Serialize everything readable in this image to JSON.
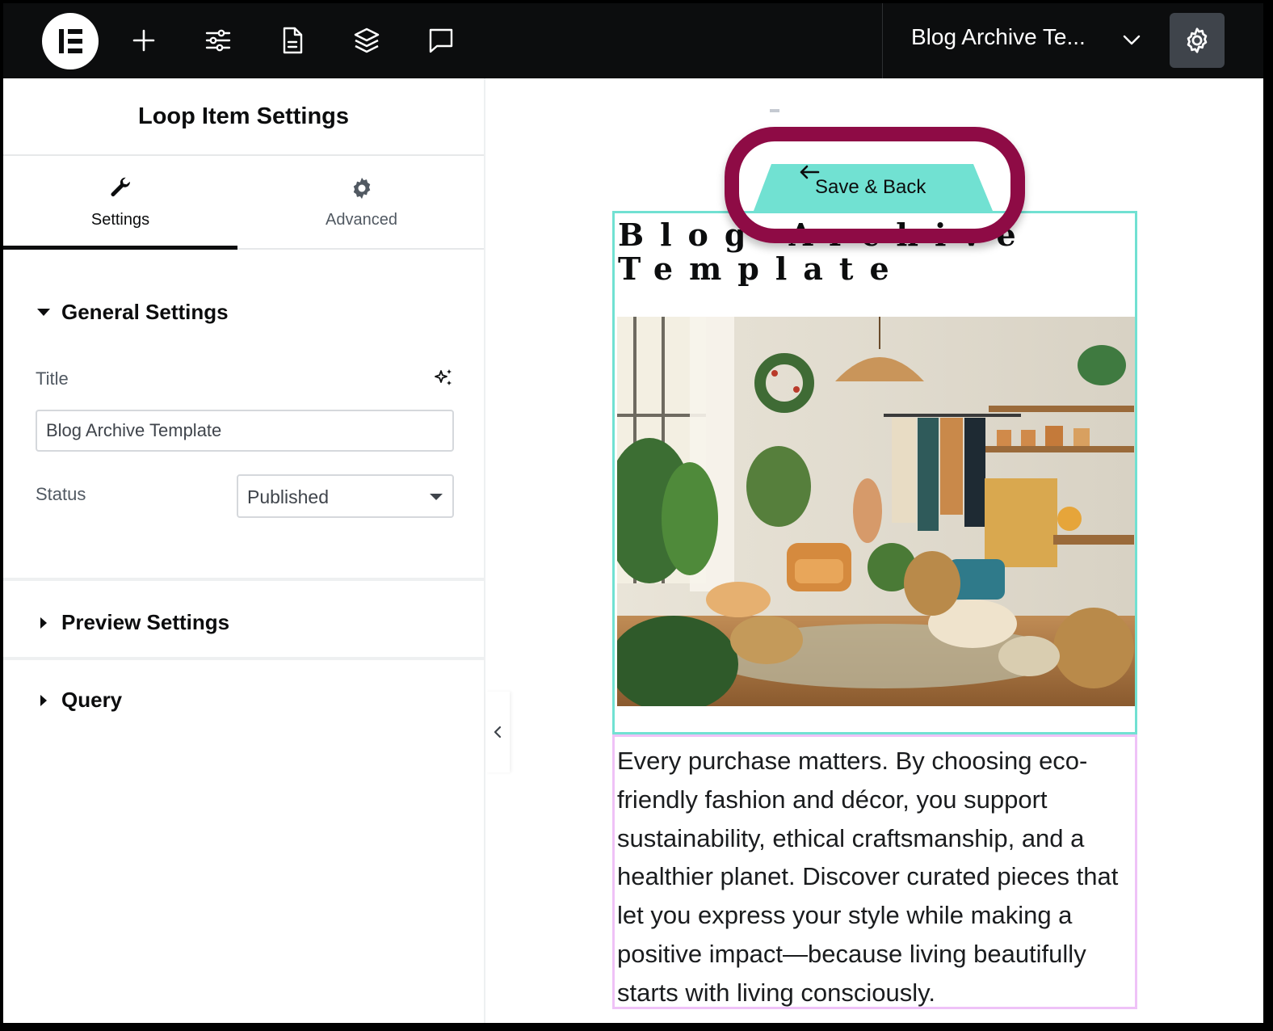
{
  "topbar": {
    "document_title": "Blog Archive Te...",
    "icons": [
      "elementor-logo-icon",
      "add-icon",
      "site-settings-sliders-icon",
      "page-icon",
      "layers-icon",
      "comments-icon",
      "chevron-down-icon",
      "gear-icon"
    ],
    "background_color": "#0c0d0e"
  },
  "panel": {
    "title": "Loop Item Settings",
    "tabs": [
      {
        "label": "Settings",
        "icon": "wrench-icon",
        "active": true
      },
      {
        "label": "Advanced",
        "icon": "gear-icon",
        "active": false
      }
    ],
    "sections": {
      "general": {
        "label": "General Settings",
        "expanded": true,
        "title_label": "Title",
        "title_value": "Blog Archive Template",
        "status_label": "Status",
        "status_value": "Published"
      },
      "preview": {
        "label": "Preview Settings",
        "expanded": false
      },
      "query": {
        "label": "Query",
        "expanded": false
      }
    }
  },
  "canvas": {
    "save_back_label": "Save & Back",
    "post_title": "Blog Archive Template",
    "excerpt": "Every purchase matters. By choosing eco-friendly fashion and décor, you support sustainability, ethical craftsmanship, and a healthier planet. Discover curated pieces that let you express your style while making a positive impact—because living beautifully starts with living consciously.",
    "accent_color": "#71e1d2",
    "excerpt_outline_color": "#efc2f7",
    "highlight_color": "#8e0b45"
  }
}
